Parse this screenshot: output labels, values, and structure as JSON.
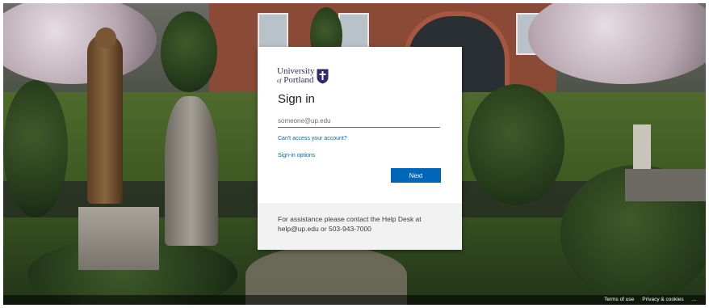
{
  "logo": {
    "line1": "University",
    "of": "of",
    "line2": "Portland"
  },
  "signin": {
    "title": "Sign in",
    "email_placeholder": "someone@up.edu",
    "cant_access_link": "Can't access your account?",
    "signin_options_link": "Sign-in options",
    "next_label": "Next"
  },
  "help": {
    "text": "For assistance please contact the Help Desk at help@up.edu or 503-943-7000"
  },
  "footer": {
    "terms": "Terms of use",
    "privacy": "Privacy & cookies",
    "more": "..."
  },
  "colors": {
    "accent": "#0067b8",
    "logo": "#2f2a6b",
    "help_bg": "#f2f2f2"
  }
}
